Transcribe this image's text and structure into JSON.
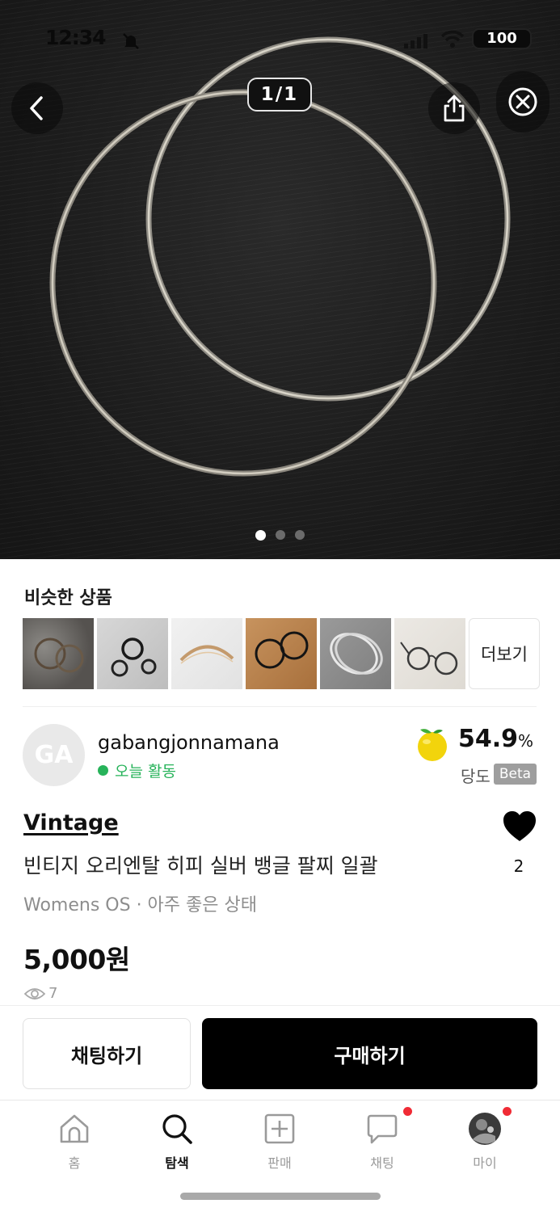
{
  "status_bar": {
    "time": "12:34",
    "battery": "100"
  },
  "viewer": {
    "page_counter": "1/1",
    "dot_count": 3,
    "active_dot": 0
  },
  "similar": {
    "title": "비슷한 상품",
    "more_label": "더보기",
    "items": [
      "rings on stone",
      "black rings on gray",
      "gold cuff",
      "dark hoops on wood",
      "silver bangles",
      "round glasses"
    ]
  },
  "seller": {
    "initials": "GA",
    "name": "gabangjonnamana",
    "activity": "오늘 활동",
    "sweetness_score": "54.9",
    "sweetness_unit": "%",
    "sweetness_label": "당도",
    "beta_label": "Beta"
  },
  "product": {
    "brand": "Vintage",
    "title": "빈티지 오리엔탈 히피 실버 뱅글 팔찌 일괄",
    "meta": "Womens OS · 아주 좋은 상태",
    "price": "5,000원",
    "views": "7",
    "likes": "2"
  },
  "actions": {
    "chat_label": "채팅하기",
    "buy_label": "구매하기"
  },
  "tabs": [
    {
      "label": "홈",
      "icon": "home-icon",
      "active": false,
      "badge": false
    },
    {
      "label": "탐색",
      "icon": "search-icon",
      "active": true,
      "badge": false
    },
    {
      "label": "판매",
      "icon": "sell-plus-icon",
      "active": false,
      "badge": false
    },
    {
      "label": "채팅",
      "icon": "chat-icon",
      "active": false,
      "badge": true
    },
    {
      "label": "마이",
      "icon": "profile-avatar",
      "active": false,
      "badge": true
    }
  ],
  "colors": {
    "accent_green": "#27b35a",
    "badge_red": "#f02b35",
    "primary_black": "#000000"
  }
}
